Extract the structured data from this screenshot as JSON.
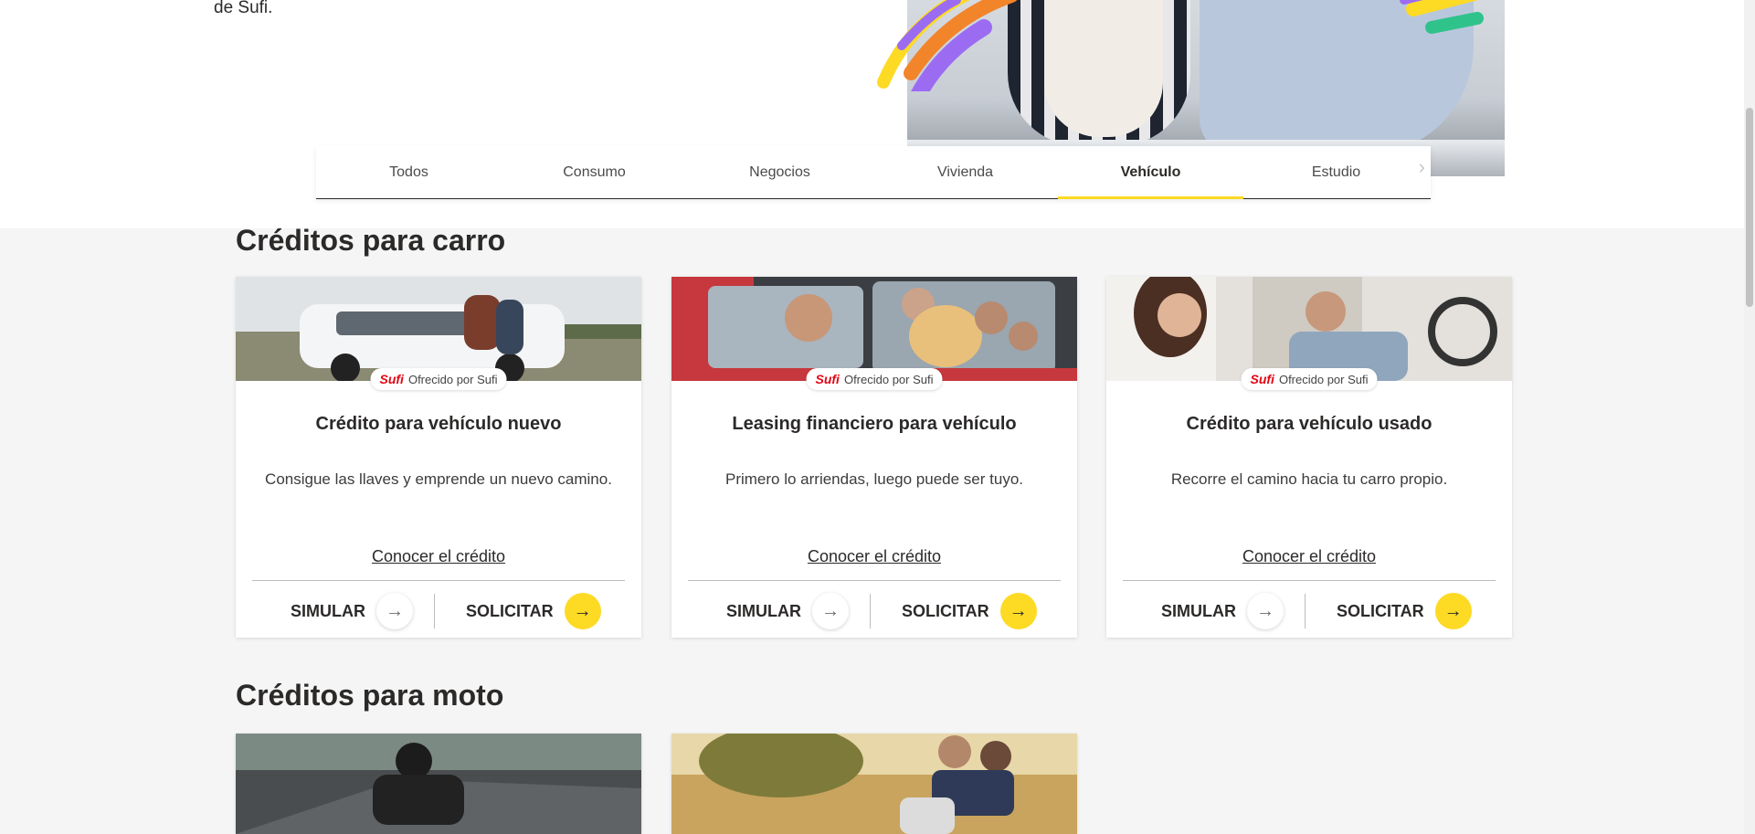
{
  "intro": {
    "text_tail": "de Sufi."
  },
  "tabs": [
    {
      "label": "Todos"
    },
    {
      "label": "Consumo"
    },
    {
      "label": "Negocios"
    },
    {
      "label": "Vivienda"
    },
    {
      "label": "Vehículo",
      "active": true
    },
    {
      "label": "Estudio"
    }
  ],
  "sections": {
    "carro": {
      "title": "Créditos para carro",
      "cards": [
        {
          "badge_logo": "Sufi",
          "badge_text": "Ofrecido por Sufi",
          "title": "Crédito para vehículo nuevo",
          "description": "Consigue las llaves y emprende un nuevo camino.",
          "link": "Conocer el crédito",
          "simulate": "SIMULAR",
          "apply": "SOLICITAR"
        },
        {
          "badge_logo": "Sufi",
          "badge_text": "Ofrecido por Sufi",
          "title": "Leasing financiero para vehículo",
          "description": "Primero lo arriendas, luego puede ser tuyo.",
          "link": "Conocer el crédito",
          "simulate": "SIMULAR",
          "apply": "SOLICITAR"
        },
        {
          "badge_logo": "Sufi",
          "badge_text": "Ofrecido por Sufi",
          "title": "Crédito para vehículo usado",
          "description": "Recorre el camino hacia tu carro propio.",
          "link": "Conocer el crédito",
          "simulate": "SIMULAR",
          "apply": "SOLICITAR"
        }
      ]
    },
    "moto": {
      "title": "Créditos para moto"
    }
  },
  "colors": {
    "accent_yellow": "#fdda24",
    "sufi_red": "#e30613",
    "text": "#2c2a29"
  },
  "icons": {
    "arrow": "→",
    "next": "›"
  }
}
